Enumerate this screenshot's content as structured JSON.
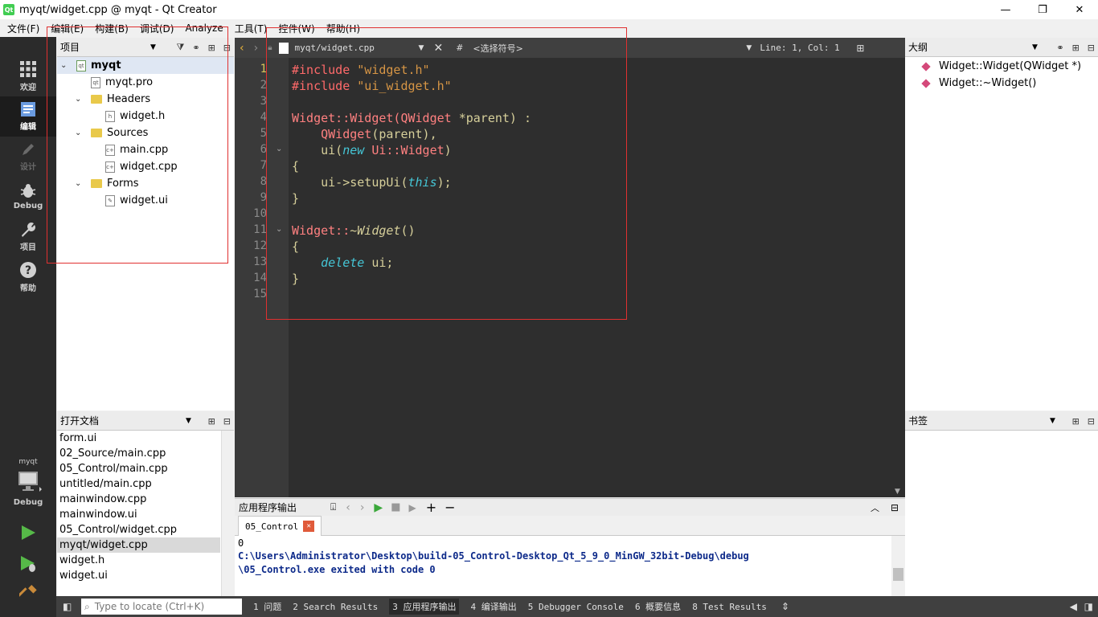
{
  "window": {
    "title": "myqt/widget.cpp @ myqt - Qt Creator",
    "logo_text": "Qt",
    "controls": [
      "—",
      "❐",
      "✕"
    ]
  },
  "menu": [
    "文件(F)",
    "编辑(E)",
    "构建(B)",
    "调试(D)",
    "Analyze",
    "工具(T)",
    "控件(W)",
    "帮助(H)"
  ],
  "modes": [
    {
      "label": "欢迎",
      "icon": "grid-icon"
    },
    {
      "label": "编辑",
      "icon": "document-icon"
    },
    {
      "label": "设计",
      "icon": "pencil-icon"
    },
    {
      "label": "Debug",
      "icon": "bug-icon"
    },
    {
      "label": "项目",
      "icon": "wrench-icon"
    },
    {
      "label": "帮助",
      "icon": "help-icon"
    }
  ],
  "kit": {
    "project": "myqt",
    "config": "Debug"
  },
  "project_panel": {
    "title": "项目",
    "tree": [
      {
        "label": "myqt",
        "kind": "project"
      },
      {
        "label": "myqt.pro",
        "kind": "file"
      },
      {
        "label": "Headers",
        "kind": "folder"
      },
      {
        "label": "widget.h",
        "kind": "file"
      },
      {
        "label": "Sources",
        "kind": "folder"
      },
      {
        "label": "main.cpp",
        "kind": "file"
      },
      {
        "label": "widget.cpp",
        "kind": "file"
      },
      {
        "label": "Forms",
        "kind": "folder"
      },
      {
        "label": "widget.ui",
        "kind": "file"
      }
    ]
  },
  "open_docs": {
    "title": "打开文档",
    "items": [
      "form.ui",
      "02_Source/main.cpp",
      "05_Control/main.cpp",
      "untitled/main.cpp",
      "mainwindow.cpp",
      "mainwindow.ui",
      "05_Control/widget.cpp",
      "myqt/widget.cpp",
      "widget.h",
      "widget.ui"
    ],
    "selected": "myqt/widget.cpp"
  },
  "editor": {
    "file": "myqt/widget.cpp",
    "symbol": "<选择符号>",
    "hash": "#",
    "position": "Line: 1, Col: 1",
    "line_numbers": [
      "1",
      "2",
      "3",
      "4",
      "5",
      "6",
      "7",
      "8",
      "9",
      "10",
      "11",
      "12",
      "13",
      "14",
      "15"
    ],
    "code": {
      "l1_pp": "#include ",
      "l1_str": "\"widget.h\"",
      "l2_pp": "#include ",
      "l2_str": "\"ui_widget.h\"",
      "l4_a": "Widget::Widget(",
      "l4_b": "QWidget",
      "l4_c": " *parent) :",
      "l5_a": "    ",
      "l5_b": "QWidget",
      "l5_c": "(parent),",
      "l6_a": "    ui(",
      "l6_b": "new",
      "l6_c": " ",
      "l6_d": "Ui::Widget",
      "l6_e": ")",
      "l7": "{",
      "l8_a": "    ui->setupUi(",
      "l8_b": "this",
      "l8_c": ");",
      "l9": "}",
      "l11_a": "Widget::",
      "l11_b": "~Widget",
      "l11_c": "()",
      "l12": "{",
      "l13_a": "    ",
      "l13_b": "delete",
      "l13_c": " ui;",
      "l14": "}"
    }
  },
  "outline": {
    "title": "大纲",
    "items": [
      "Widget::Widget(QWidget *)",
      "Widget::~Widget()"
    ]
  },
  "bookmarks": {
    "title": "书签"
  },
  "output": {
    "title": "应用程序输出",
    "tab": "05_Control",
    "lines": [
      "0",
      "C:\\Users\\Administrator\\Desktop\\build-05_Control-Desktop_Qt_5_9_0_MinGW_32bit-Debug\\debug",
      "\\05_Control.exe exited with code 0"
    ]
  },
  "statusbar": {
    "locate_placeholder": "Type to locate (Ctrl+K)",
    "tabs": [
      "1 问题",
      "2 Search Results",
      "3 应用程序输出",
      "4 编译输出",
      "5 Debugger Console",
      "6 概要信息",
      "8 Test Results"
    ]
  },
  "colors": {
    "annotation": "#e03030",
    "selected_line_number": "#d6c55a",
    "mode_bar": "#2b2b2b"
  }
}
